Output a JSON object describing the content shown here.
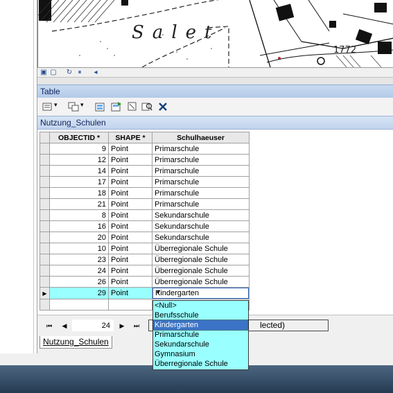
{
  "table_window": {
    "title": "Table",
    "layer_name": "Nutzung_Schulen",
    "columns": [
      "OBJECTID *",
      "SHAPE *",
      "Schulhaeuser"
    ],
    "rows": [
      {
        "objectid": "9",
        "shape": "Point",
        "schulhaeuser": "Primarschule"
      },
      {
        "objectid": "12",
        "shape": "Point",
        "schulhaeuser": "Primarschule"
      },
      {
        "objectid": "14",
        "shape": "Point",
        "schulhaeuser": "Primarschule"
      },
      {
        "objectid": "17",
        "shape": "Point",
        "schulhaeuser": "Primarschule"
      },
      {
        "objectid": "18",
        "shape": "Point",
        "schulhaeuser": "Primarschule"
      },
      {
        "objectid": "21",
        "shape": "Point",
        "schulhaeuser": "Primarschule"
      },
      {
        "objectid": "8",
        "shape": "Point",
        "schulhaeuser": "Sekundarschule"
      },
      {
        "objectid": "16",
        "shape": "Point",
        "schulhaeuser": "Sekundarschule"
      },
      {
        "objectid": "20",
        "shape": "Point",
        "schulhaeuser": "Sekundarschule"
      },
      {
        "objectid": "10",
        "shape": "Point",
        "schulhaeuser": "Überregionale Schule"
      },
      {
        "objectid": "23",
        "shape": "Point",
        "schulhaeuser": "Überregionale Schule"
      },
      {
        "objectid": "24",
        "shape": "Point",
        "schulhaeuser": "Überregionale Schule"
      },
      {
        "objectid": "26",
        "shape": "Point",
        "schulhaeuser": "Überregionale Schule"
      }
    ],
    "active_row": {
      "objectid": "29",
      "shape": "Point",
      "schulhaeuser": "Kindergarten"
    },
    "dropdown_options": [
      "<Null>",
      "Berufsschule",
      "Kindergarten",
      "Primarschule",
      "Sekundarschule",
      "Gymnasium",
      "Überregionale Schule"
    ],
    "dropdown_selected": "Kindergarten",
    "nav": {
      "record": "24",
      "status_visible": "lected)"
    },
    "bottom_tab": "Nutzung_Schulen"
  },
  "map": {
    "labels": {
      "salet": "Salet",
      "elevation": "1772"
    }
  },
  "colors": {
    "active_row": "#99ffff",
    "selection": "#3b73c6",
    "title_bar": "#c9dbf1"
  },
  "icons": [
    "table-options-icon",
    "related-tables-icon",
    "select-by-attributes-icon",
    "switch-selection-icon",
    "clear-selection-icon",
    "zoom-to-selected-icon",
    "delete-selected-icon",
    "first-record-icon",
    "previous-record-icon",
    "next-record-icon",
    "last-record-icon"
  ]
}
